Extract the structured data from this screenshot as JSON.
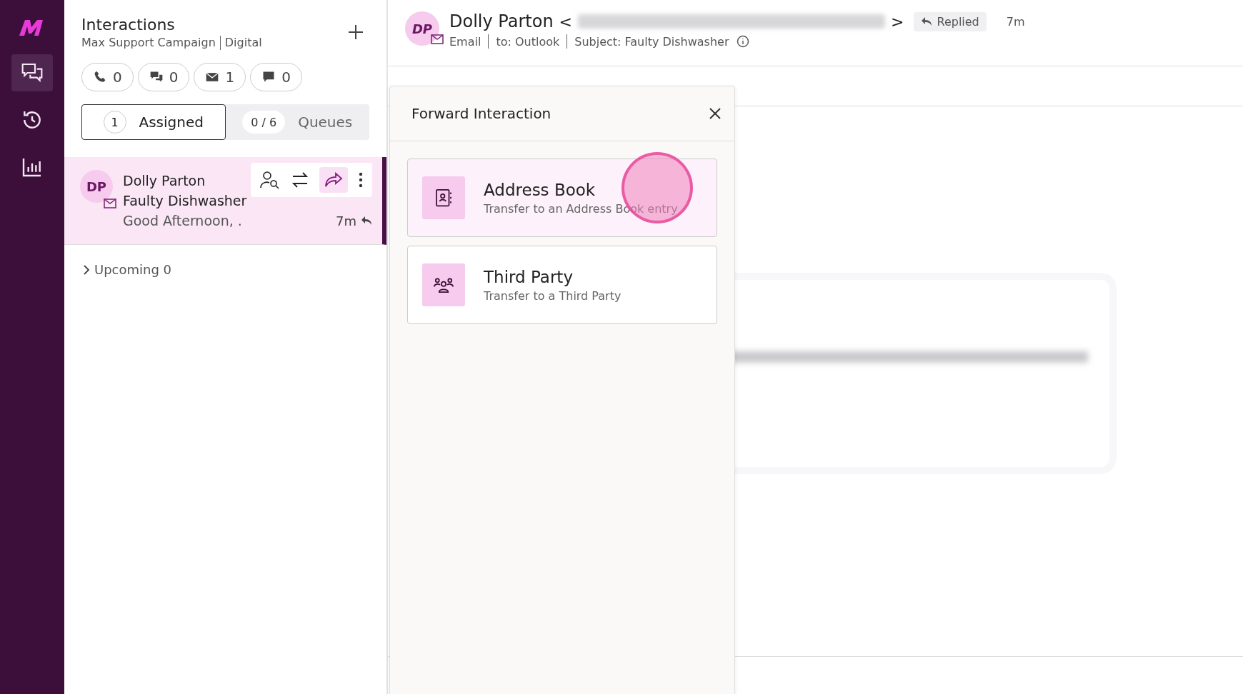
{
  "nav": {
    "items": [
      {
        "selected": true
      },
      {
        "selected": false
      },
      {
        "selected": false
      }
    ]
  },
  "panel": {
    "title": "Interactions",
    "subtitle": "Max Support Campaign",
    "channel": "Digital",
    "counters": [
      {
        "count": "0"
      },
      {
        "count": "0"
      },
      {
        "count": "1"
      },
      {
        "count": "0"
      }
    ],
    "tabs": [
      {
        "label": "Assigned",
        "badge": "1",
        "selected": true
      },
      {
        "label": "Queues",
        "badge": "0 / 6",
        "selected": false
      }
    ],
    "items": [
      {
        "initials": "DP",
        "name": "Dolly Parton",
        "subject": "Faulty Dishwasher",
        "preview": "Good Afternoon, .",
        "time": "7m",
        "selected": true
      }
    ],
    "upcoming": {
      "label": "Upcoming 0",
      "expanded": false
    }
  },
  "header": {
    "initials": "DP",
    "name": "Dolly Parton",
    "email_open": "<",
    "email_close": ">",
    "status": "Replied",
    "time": "7m",
    "channel": "Email",
    "to": "to: Outlook",
    "subject": "Subject: Faulty Dishwasher"
  },
  "dialog": {
    "title": "Forward Interaction",
    "options": [
      {
        "title": "Address Book",
        "description": "Transfer to an Address Book entry",
        "selected": true
      },
      {
        "title": "Third Party",
        "description": "Transfer to a Third Party",
        "selected": false
      }
    ]
  }
}
